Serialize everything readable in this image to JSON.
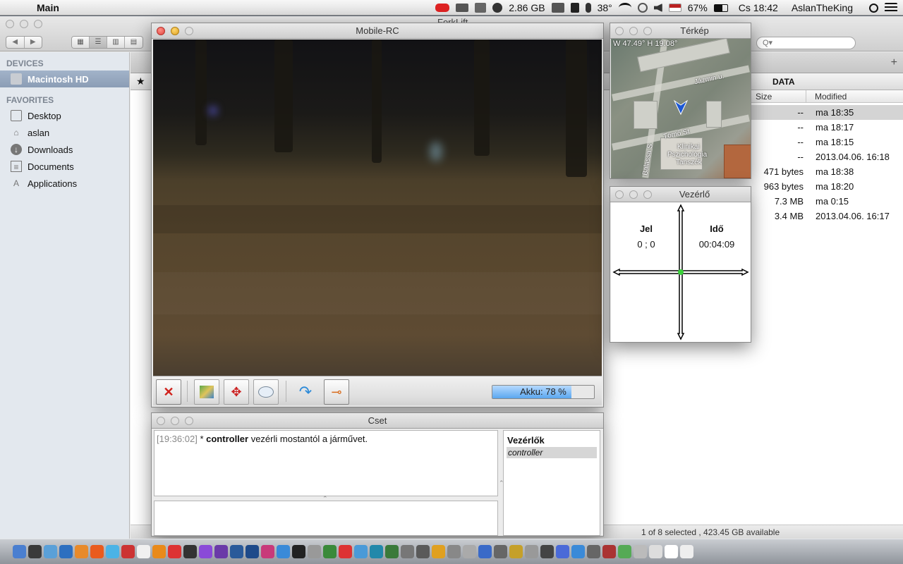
{
  "menubar": {
    "app_name": "Main",
    "memory": "2.86 GB",
    "temperature": "38°",
    "battery_percent": "67%",
    "clock": "Cs 18:42",
    "user": "AslanTheKing"
  },
  "forklift": {
    "title": "ForkLift",
    "search_placeholder": "Q▾",
    "sidebar": {
      "devices_heading": "DEVICES",
      "devices": [
        {
          "label": "Macintosh HD",
          "icon": "harddisk-icon"
        }
      ],
      "favorites_heading": "FAVORITES",
      "favorites": [
        {
          "label": "Desktop",
          "icon": "desktop-icon"
        },
        {
          "label": "aslan",
          "icon": "home-icon"
        },
        {
          "label": "Downloads",
          "icon": "downloads-icon"
        },
        {
          "label": "Documents",
          "icon": "documents-icon"
        },
        {
          "label": "Applications",
          "icon": "applications-icon"
        }
      ]
    },
    "tab_label": "DATA",
    "columns": {
      "size": "Size",
      "modified": "Modified"
    },
    "rows": [
      {
        "size": "--",
        "modified": "ma 18:35",
        "selected": true
      },
      {
        "size": "--",
        "modified": "ma 18:17",
        "selected": false
      },
      {
        "size": "--",
        "modified": "ma 18:15",
        "selected": false
      },
      {
        "size": "--",
        "modified": "2013.04.06. 16:18",
        "selected": false
      },
      {
        "size": "471 bytes",
        "modified": "ma 18:38",
        "selected": false
      },
      {
        "size": "963 bytes",
        "modified": "ma 18:20",
        "selected": false
      },
      {
        "size": "7.3 MB",
        "modified": "ma 0:15",
        "selected": false
      },
      {
        "size": "3.4 MB",
        "modified": "2013.04.06. 16:17",
        "selected": false
      }
    ],
    "status": "1 of 8 selected , 423.45 GB available"
  },
  "mobile_rc": {
    "title": "Mobile-RC",
    "toolbar": [
      {
        "name": "disconnect-button",
        "icon": "no-connection-icon"
      },
      {
        "name": "map-button",
        "icon": "map-icon"
      },
      {
        "name": "control-button",
        "icon": "move-arrows-icon"
      },
      {
        "name": "chat-button",
        "icon": "speech-bubble-icon"
      },
      {
        "name": "refresh-button",
        "icon": "refresh-arrow-icon"
      },
      {
        "name": "horn-button",
        "icon": "horn-icon"
      }
    ],
    "battery_label": "Akku: 78 %",
    "battery_level": 0.78,
    "battery_color": "#5aa7ef"
  },
  "map_window": {
    "title": "Térkép",
    "coords": "W 47.49° H 19.08°",
    "labels": {
      "street1": "Jázmin u.",
      "street2": "Tömő St",
      "street3": "Balassa S",
      "poi1": "Klinikai",
      "poi2": "Pszichológia",
      "poi3": "Tanszék"
    }
  },
  "controller_window": {
    "title": "Vezérlő",
    "signal_label": "Jel",
    "signal_value": "0 ; 0",
    "time_label": "Idő",
    "time_value": "00:04:09",
    "stick_color": "#3ad23a"
  },
  "chat_window": {
    "title": "Cset",
    "messages": [
      {
        "time": "[19:36:02]",
        "prefix": " * ",
        "user": "controller",
        "text": " vezérli mostantól a járművet."
      }
    ],
    "users_heading": "Vezérlők",
    "users": [
      "controller"
    ]
  }
}
